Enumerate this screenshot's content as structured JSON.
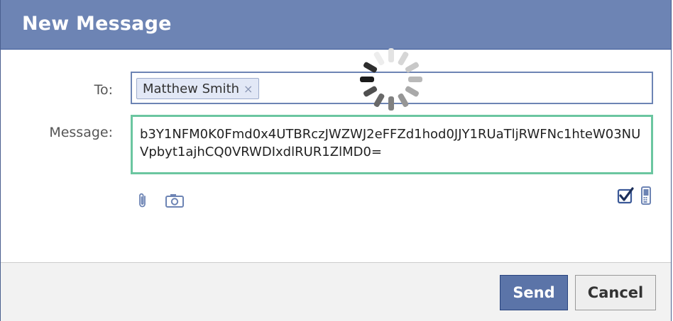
{
  "dialog": {
    "title": "New Message"
  },
  "form": {
    "to_label": "To:",
    "message_label": "Message:",
    "recipients": [
      {
        "name": "Matthew Smith",
        "remove_glyph": "×"
      }
    ],
    "message_text": "b3Y1NFM0K0Fmd0x4UTBRczJWZWJ2eFFZd1hod0JJY1RUaTljRWFNc1hteW03NUVpbyt1ajhCQ0VRWDIxdlRUR1ZlMD0="
  },
  "toolbar": {
    "icons": [
      "paperclip-icon",
      "camera-icon",
      "checkbox-checked-icon",
      "mobile-phone-icon"
    ]
  },
  "footer": {
    "send_label": "Send",
    "cancel_label": "Cancel"
  },
  "colors": {
    "header_bg": "#6d84b4",
    "send_bg": "#5b74a8",
    "message_border": "#6bc6a0",
    "to_border": "#6d84b4"
  }
}
